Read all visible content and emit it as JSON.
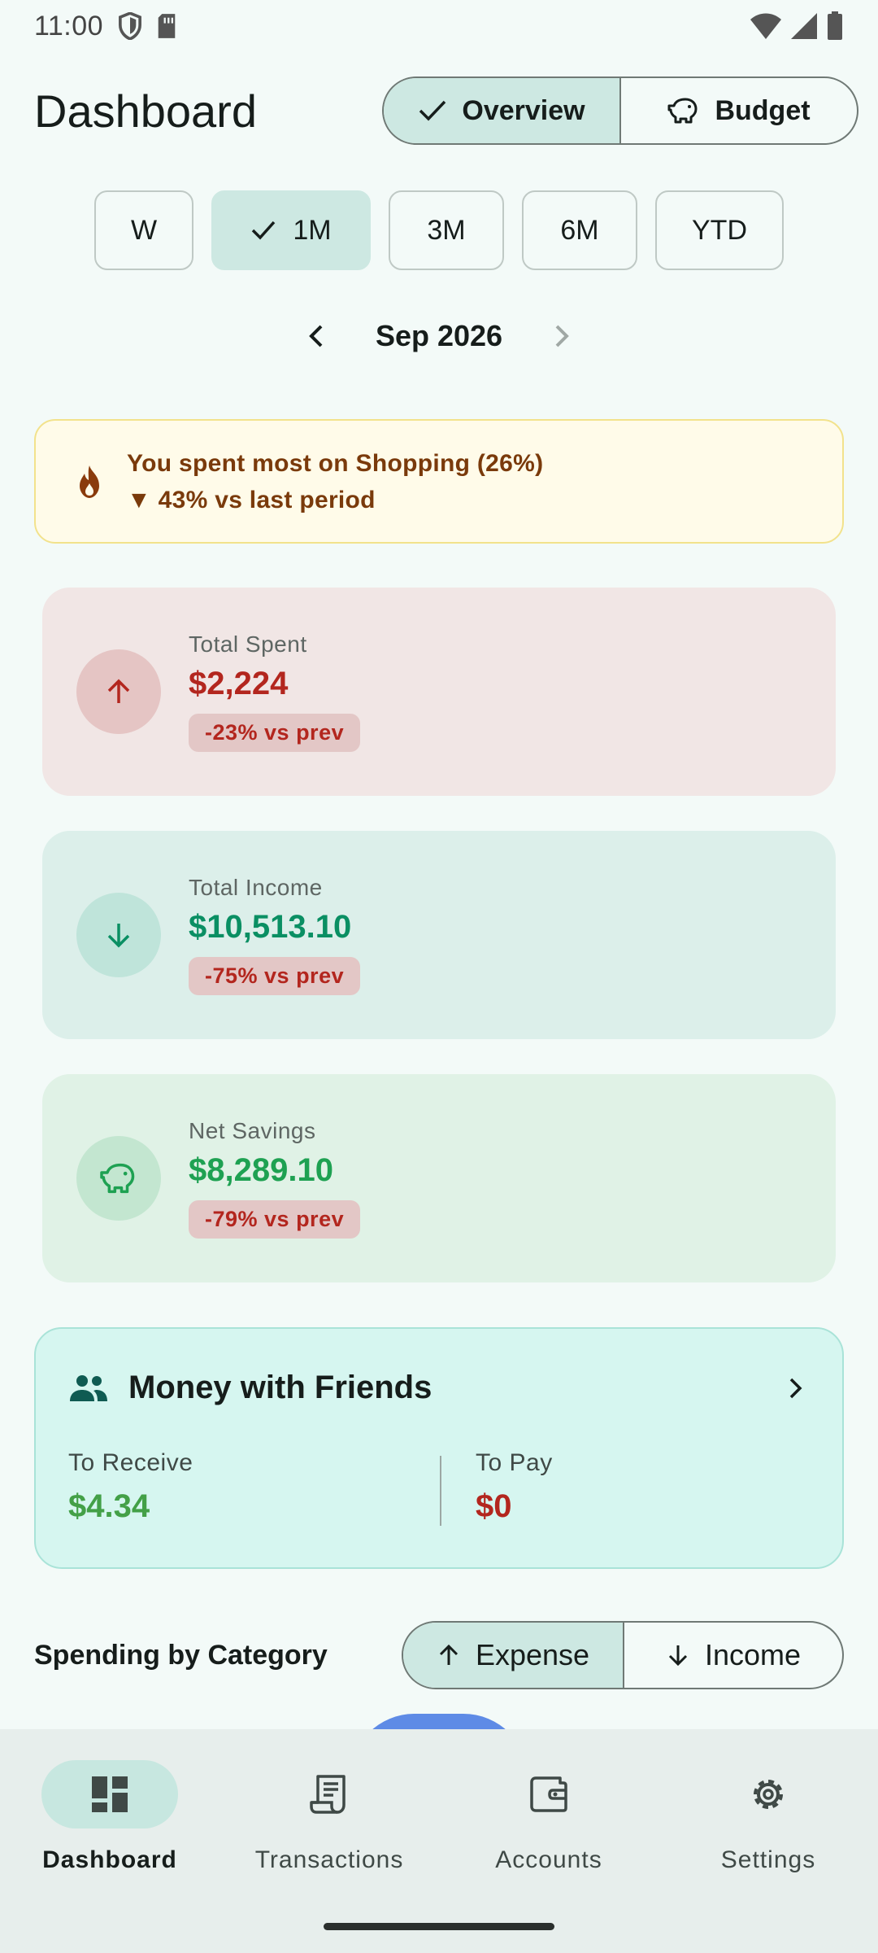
{
  "status": {
    "time": "11:00"
  },
  "header": {
    "title": "Dashboard",
    "view_toggle": {
      "overview": "Overview",
      "budget": "Budget",
      "selected": "Overview"
    }
  },
  "periods": {
    "items": [
      "W",
      "1M",
      "3M",
      "6M",
      "YTD"
    ],
    "selected": "1M"
  },
  "month": {
    "label": "Sep 2026"
  },
  "insight": {
    "line1": "You spent most on Shopping (26%)",
    "line2": "▼ 43% vs last period"
  },
  "cards": {
    "spent": {
      "label": "Total Spent",
      "value": "$2,224",
      "badge": "-23% vs prev"
    },
    "income": {
      "label": "Total Income",
      "value": "$10,513.10",
      "badge": "-75% vs prev"
    },
    "savings": {
      "label": "Net Savings",
      "value": "$8,289.10",
      "badge": "-79% vs prev"
    }
  },
  "friends": {
    "title": "Money with Friends",
    "receive_label": "To Receive",
    "receive_value": "$4.34",
    "pay_label": "To Pay",
    "pay_value": "$0"
  },
  "spending": {
    "title": "Spending by Category",
    "expense_label": "Expense",
    "income_label": "Income",
    "selected": "Expense"
  },
  "nav": {
    "items": [
      "Dashboard",
      "Transactions",
      "Accounts",
      "Settings"
    ],
    "selected": "Dashboard"
  },
  "colors": {
    "accent": "#CDE8E2",
    "expense": "#B3261E",
    "income": "#0A8F63",
    "savings": "#1EA152",
    "friends_receive": "#43A047"
  }
}
